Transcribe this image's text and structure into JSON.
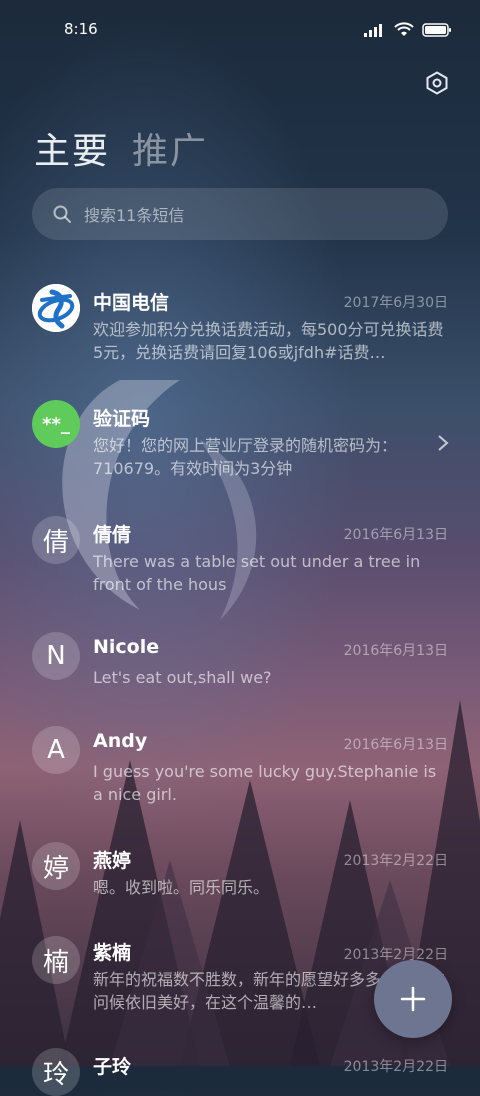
{
  "status_bar": {
    "time": "8:16",
    "battery": "battery-icon",
    "wifi": "wifi-icon",
    "signal": "signal-icon"
  },
  "tabs": [
    {
      "label": "主要",
      "active": true
    },
    {
      "label": "推广",
      "active": false
    }
  ],
  "search": {
    "placeholder": "搜索11条短信"
  },
  "messages": [
    {
      "avatar_text": "",
      "avatar_icon": "china-telecom-logo",
      "sender": "中国电信",
      "date": "2017年6月30日",
      "preview": "欢迎参加积分兑换话费活动，每500分可兑换话费5元，兑换话费请回复106或jfdh#话费…"
    },
    {
      "avatar_text": "**_",
      "sender": "验证码",
      "date": "",
      "preview": "您好！您的网上营业厅登录的随机密码为：710679。有效时间为3分钟"
    },
    {
      "avatar_text": "倩",
      "sender": "倩倩",
      "date": "2016年6月13日",
      "preview": "There was a table set out under a tree in front of the hous"
    },
    {
      "avatar_text": "N",
      "sender": "Nicole",
      "date": "2016年6月13日",
      "preview": "Let's eat out,shall we?"
    },
    {
      "avatar_text": "A",
      "sender": "Andy",
      "date": "2016年6月13日",
      "preview": "I guess you're some lucky guy.Stephanie is a nice girl."
    },
    {
      "avatar_text": "婷",
      "sender": "燕婷",
      "date": "2013年2月22日",
      "preview": "嗯。收到啦。同乐同乐。"
    },
    {
      "avatar_text": "楠",
      "sender": "紫楠",
      "date": "2013年2月22日",
      "preview": "新年的祝福数不胜数，新年的愿望好多多，新年的问候依旧美好，在这个温馨的…"
    },
    {
      "avatar_text": "玲",
      "sender": "子玲",
      "date": "2013年2月22日",
      "preview": ""
    }
  ],
  "colors": {
    "verify_avatar": "#5ecb5a",
    "telecom_blue": "#1f72c8",
    "fab": "#6e7591"
  },
  "fab": {
    "icon": "plus-icon"
  }
}
